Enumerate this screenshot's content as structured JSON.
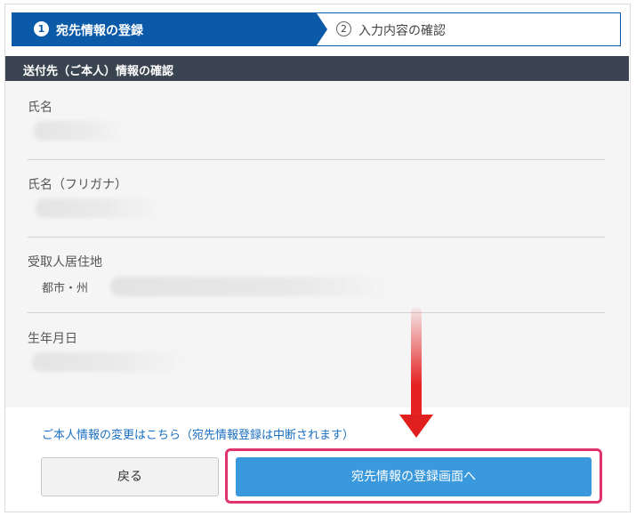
{
  "stepper": {
    "step1": {
      "number": "1",
      "label": "宛先情報の登録"
    },
    "step2": {
      "number": "2",
      "label": "入力内容の確認"
    }
  },
  "section": {
    "title": "送付先（ご本人）情報の確認"
  },
  "fields": {
    "name": {
      "label": "氏名"
    },
    "name_kana": {
      "label": "氏名（フリガナ）"
    },
    "address": {
      "label": "受取人居住地",
      "sub_label": "都市・州"
    },
    "birthdate": {
      "label": "生年月日"
    }
  },
  "links": {
    "change_info": "ご本人情報の変更はこちら（宛先情報登録は中断されます）"
  },
  "buttons": {
    "back": "戻る",
    "next": "宛先情報の登録画面へ"
  },
  "colors": {
    "primary": "#0a5aa8",
    "button": "#3a99dc",
    "highlight": "#e0336b",
    "arrow": "#e01f1f",
    "header": "#3a4450"
  }
}
